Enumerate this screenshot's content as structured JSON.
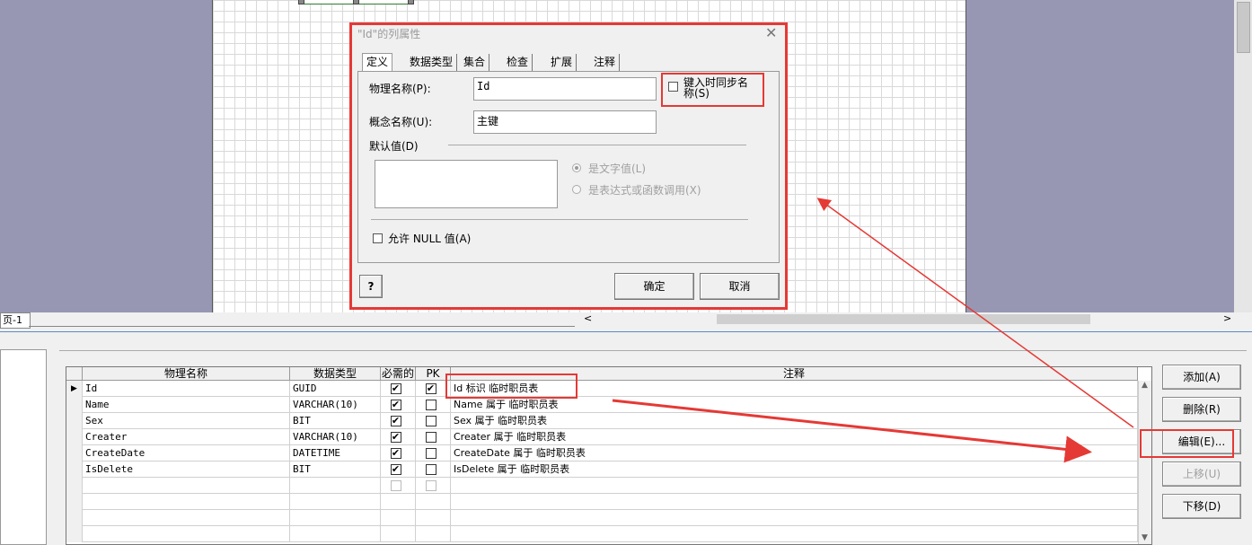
{
  "dialog": {
    "title": "\"Id\"的列属性",
    "close_glyph": "✕",
    "tabs": [
      "定义",
      "数据类型",
      "集合",
      "检查",
      "扩展",
      "注释"
    ],
    "physical_name_label": "物理名称(P):",
    "physical_name_value": "Id",
    "sync_label_line1": "键入时同步名",
    "sync_label_line2": "称(S)",
    "concept_name_label": "概念名称(U):",
    "concept_name_value": "主键",
    "default_label": "默认值(D)",
    "radio_literal": "是文字值(L)",
    "radio_expression": "是表达式或函数调用(X)",
    "allow_null_label": "允许 NULL 值(A)",
    "help_glyph": "?",
    "ok_label": "确定",
    "cancel_label": "取消"
  },
  "sheet_tab_label": "页-1",
  "grid": {
    "headers": [
      "物理名称",
      "数据类型",
      "必需的",
      "PK",
      "注释"
    ],
    "rows": [
      {
        "name": "Id",
        "type": "GUID",
        "required": true,
        "pk": true,
        "comment": "Id 标识 临时职员表"
      },
      {
        "name": "Name",
        "type": "VARCHAR(10)",
        "required": true,
        "pk": false,
        "comment": "Name 属于 临时职员表"
      },
      {
        "name": "Sex",
        "type": "BIT",
        "required": true,
        "pk": false,
        "comment": "Sex 属于 临时职员表"
      },
      {
        "name": "Creater",
        "type": "VARCHAR(10)",
        "required": true,
        "pk": false,
        "comment": "Creater 属于 临时职员表"
      },
      {
        "name": "CreateDate",
        "type": "DATETIME",
        "required": true,
        "pk": false,
        "comment": "CreateDate 属于 临时职员表"
      },
      {
        "name": "IsDelete",
        "type": "BIT",
        "required": true,
        "pk": false,
        "comment": "IsDelete 属于 临时职员表"
      }
    ]
  },
  "side_buttons": {
    "add": "添加(A)",
    "delete": "删除(R)",
    "edit": "编辑(E)...",
    "move_up": "上移(U)",
    "move_down": "下移(D)"
  },
  "colors": {
    "highlight": "#e53935"
  }
}
